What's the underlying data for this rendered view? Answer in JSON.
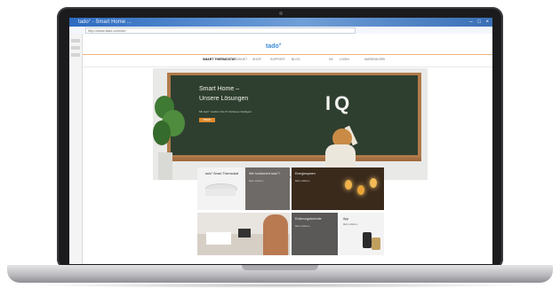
{
  "browser": {
    "window_title": "tado° - Smart Home ...",
    "controls": "– □ ×",
    "address": "http://www.tado.com/de/"
  },
  "site": {
    "logo": "tado°",
    "nav": [
      "SMART THERMOSTAT",
      "PRODUKT",
      "SHOP",
      "SUPPORT",
      "BLOG"
    ],
    "nav_right": [
      "DE",
      "LOGIN",
      "WARENKORB"
    ]
  },
  "hero": {
    "title_line1": "Smart Home –",
    "title_line2": "Unsere Lösungen",
    "subtitle": "Mit tado° machen Sie Ihr Zuhause intelligent.",
    "button": "MEHR",
    "board_text": "IQ",
    "carousel_dots": "● ● ● ●"
  },
  "tiles": [
    {
      "title": "tado° Smart Thermostat",
      "text": "",
      "bg": "#f3f3f3",
      "image": "thermostat"
    },
    {
      "title": "Wie funktioniert tado°?",
      "text": "Mehr erfahren",
      "bg": "#6d6a68",
      "image": ""
    },
    {
      "title": "Energiesparen",
      "text": "Mehr erfahren",
      "bg": "#3a2a1c",
      "image": "bulbs"
    },
    {
      "title": "",
      "text": "",
      "bg": "#e8e4df",
      "image": "room"
    },
    {
      "title": "Erfahrungsberichte",
      "text": "Mehr erfahren",
      "bg": "#5b5957",
      "image": ""
    },
    {
      "title": "App",
      "text": "Mehr erfahren",
      "bg": "#f3f3f3",
      "image": "app"
    }
  ],
  "colors": {
    "accent": "#e08a2b",
    "logo": "#3d8bd6",
    "chalkboard": "#2e3f30",
    "window_bar": "#2e6bbf"
  }
}
